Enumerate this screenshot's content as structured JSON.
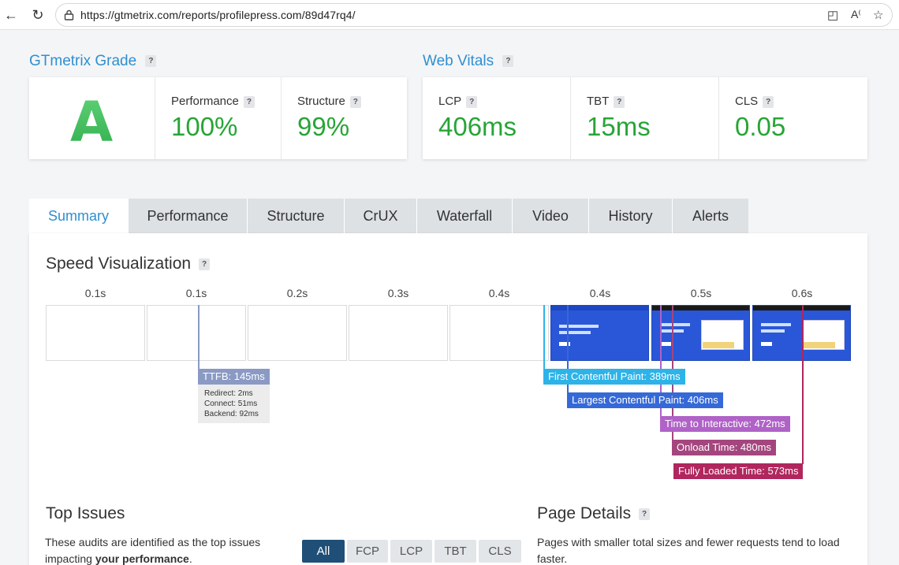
{
  "browser": {
    "url": "https://gtmetrix.com/reports/profilepress.com/89d47rq4/"
  },
  "grade": {
    "title": "GTmetrix Grade",
    "letter": "A",
    "performance_label": "Performance",
    "performance_value": "100%",
    "structure_label": "Structure",
    "structure_value": "99%"
  },
  "vitals": {
    "title": "Web Vitals",
    "lcp_label": "LCP",
    "lcp_value": "406ms",
    "tbt_label": "TBT",
    "tbt_value": "15ms",
    "cls_label": "CLS",
    "cls_value": "0.05"
  },
  "help_glyph": "?",
  "tabs": [
    {
      "label": "Summary"
    },
    {
      "label": "Performance"
    },
    {
      "label": "Structure"
    },
    {
      "label": "CrUX"
    },
    {
      "label": "Waterfall"
    },
    {
      "label": "Video"
    },
    {
      "label": "History"
    },
    {
      "label": "Alerts"
    }
  ],
  "speed": {
    "title": "Speed Visualization",
    "frame_times": [
      "0.1s",
      "0.1s",
      "0.2s",
      "0.3s",
      "0.4s",
      "0.4s",
      "0.5s",
      "0.6s"
    ],
    "ttfb": {
      "label": "TTFB: 145ms",
      "redirect": "Redirect: 2ms",
      "connect": "Connect: 51ms",
      "backend": "Backend: 92ms"
    },
    "markers": {
      "fcp": "First Contentful Paint: 389ms",
      "lcp": "Largest Contentful Paint: 406ms",
      "tti": "Time to Interactive: 472ms",
      "onload": "Onload Time: 480ms",
      "fully": "Fully Loaded Time: 573ms"
    },
    "colors": {
      "ttfb": "#8a9ac4",
      "fcp": "#2db3e8",
      "lcp": "#3569d8",
      "tti": "#b062c7",
      "onload": "#a4467e",
      "fully": "#b0275e"
    }
  },
  "top_issues": {
    "title": "Top Issues",
    "desc_line1": "These audits are identified as the top issues",
    "desc_line2_pre": "impacting ",
    "desc_line2_bold": "your performance",
    "desc_line2_post": ".",
    "filters": [
      "All",
      "FCP",
      "LCP",
      "TBT",
      "CLS"
    ]
  },
  "page_details": {
    "title": "Page Details",
    "desc_line1": "Pages with smaller total sizes and fewer requests tend to load",
    "desc_line2": "faster."
  }
}
